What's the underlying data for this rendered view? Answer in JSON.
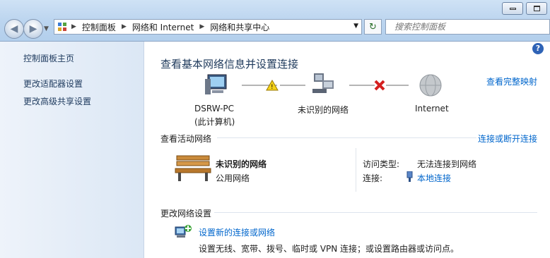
{
  "titlebar": {
    "minimize_icon": "minimize-icon",
    "maximize_icon": "maximize-icon"
  },
  "address": {
    "crumbs": [
      "控制面板",
      "网络和 Internet",
      "网络和共享中心"
    ]
  },
  "search": {
    "placeholder": "搜索控制面板"
  },
  "sidebar": {
    "items": [
      {
        "label": "控制面板主页"
      },
      {
        "label": "更改适配器设置"
      },
      {
        "label": "更改高级共享设置"
      }
    ]
  },
  "main": {
    "title": "查看基本网络信息并设置连接",
    "full_map_link": "查看完整映射",
    "map": {
      "computer_name": "DSRW-PC",
      "computer_sub": "(此计算机)",
      "network_label": "未识别的网络",
      "internet_label": "Internet"
    },
    "active_networks": {
      "heading": "查看活动网络",
      "connect_link": "连接或断开连接",
      "network_name": "未识别的网络",
      "network_type": "公用网络",
      "access_type_label": "访问类型:",
      "access_type_value": "无法连接到网络",
      "connection_label": "连接:",
      "connection_value": "本地连接"
    },
    "change_settings": {
      "heading": "更改网络设置",
      "new_connection_link": "设置新的连接或网络",
      "new_connection_desc": "设置无线、宽带、拨号、临时或 VPN 连接；或设置路由器或访问点。"
    }
  },
  "colors": {
    "link": "#0066cc",
    "heading": "#1e395b",
    "sidebar_bg": "#dbe7f5"
  }
}
